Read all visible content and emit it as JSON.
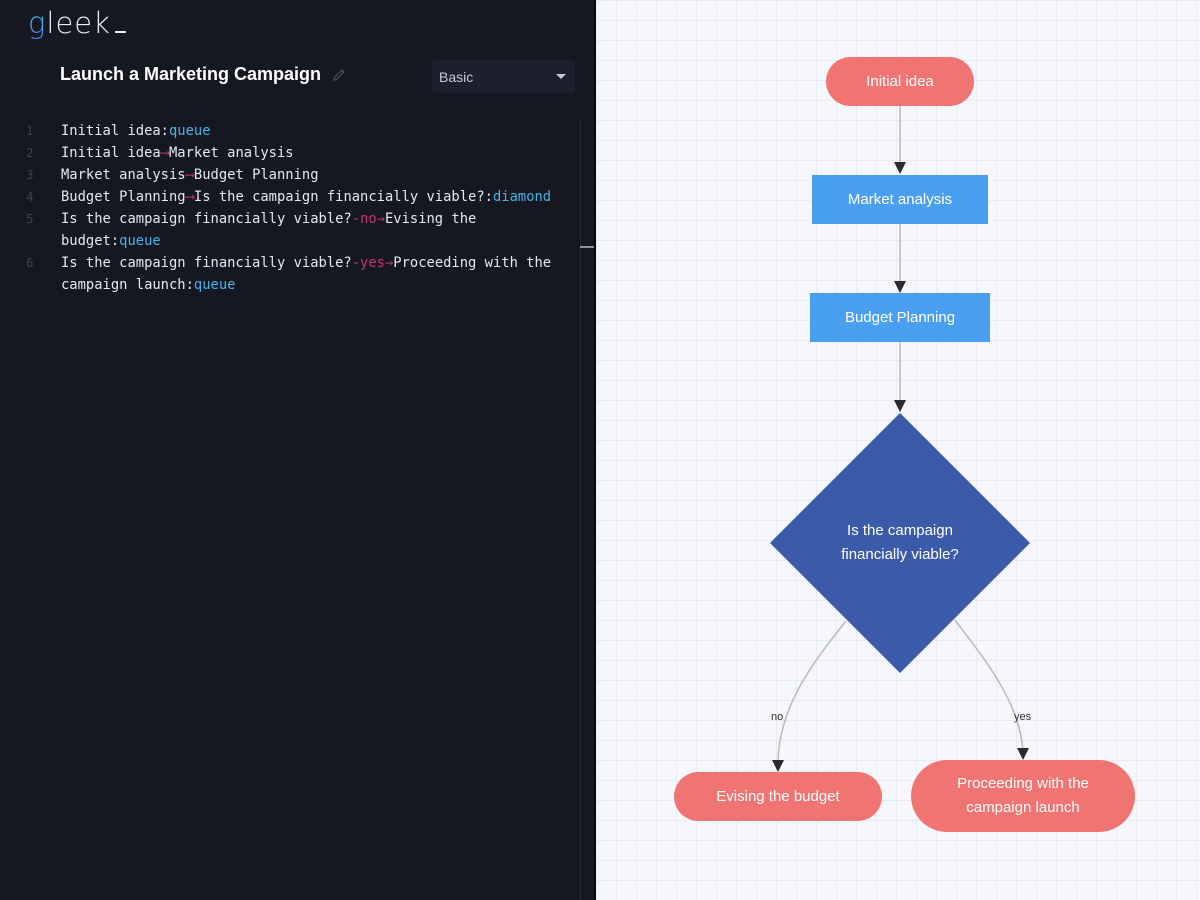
{
  "app": {
    "logo_first": "g",
    "logo_rest": "leek"
  },
  "header": {
    "title": "Launch a Marketing Campaign",
    "edit_icon": "pencil-icon",
    "diagram_style": {
      "selected": "Basic",
      "icon": "caret-down-icon"
    }
  },
  "editor": {
    "lines": [
      {
        "num": "1",
        "parts": [
          {
            "t": "Initial idea:",
            "c": "txt"
          },
          {
            "t": "queue",
            "c": "kw"
          }
        ]
      },
      {
        "num": "2",
        "parts": [
          {
            "t": "Initial idea",
            "c": "txt"
          },
          {
            "t": "⟶",
            "c": "arrow"
          },
          {
            "t": "Market analysis",
            "c": "txt"
          }
        ]
      },
      {
        "num": "3",
        "parts": [
          {
            "t": "Market analysis",
            "c": "txt"
          },
          {
            "t": "⟶",
            "c": "arrow"
          },
          {
            "t": "Budget Planning",
            "c": "txt"
          }
        ]
      },
      {
        "num": "4",
        "parts": [
          {
            "t": "Budget Planning",
            "c": "txt"
          },
          {
            "t": "⟶",
            "c": "arrow"
          },
          {
            "t": "Is the campaign financially viable?:",
            "c": "txt"
          },
          {
            "t": "diamond",
            "c": "kw"
          }
        ]
      },
      {
        "num": "5",
        "parts": [
          {
            "t": "Is the campaign financially viable?",
            "c": "txt"
          },
          {
            "t": "-no→",
            "c": "arrow"
          },
          {
            "t": "Evising the budget:",
            "c": "txt"
          },
          {
            "t": "queue",
            "c": "kw"
          }
        ]
      },
      {
        "num": "6",
        "parts": [
          {
            "t": "Is the campaign financially viable?",
            "c": "txt"
          },
          {
            "t": "-yes→",
            "c": "arrow"
          },
          {
            "t": "Proceeding with the campaign launch:",
            "c": "txt"
          },
          {
            "t": "queue",
            "c": "kw"
          }
        ]
      }
    ]
  },
  "diagram": {
    "colors": {
      "terminal": "#f07572",
      "process": "#4b9ff0",
      "decision": "#3b5baa",
      "edge": "#b8b9c2",
      "arrowhead": "#2b2b2b"
    },
    "nodes": {
      "initial": "Initial idea",
      "market": "Market analysis",
      "budget": "Budget Planning",
      "decision_line1": "Is the campaign",
      "decision_line2": "financially viable?",
      "evising": "Evising the budget",
      "proceed_line1": "Proceeding with the",
      "proceed_line2": "campaign launch"
    },
    "edge_labels": {
      "no": "no",
      "yes": "yes"
    }
  }
}
